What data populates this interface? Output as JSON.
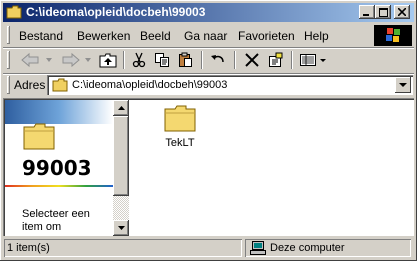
{
  "window": {
    "title": "C:\\ideoma\\opleid\\docbeh\\99003"
  },
  "menubar": {
    "items": [
      {
        "label": "Bestand"
      },
      {
        "label": "Bewerken"
      },
      {
        "label": "Beeld"
      },
      {
        "label": "Ga naar"
      },
      {
        "label": "Favorieten"
      },
      {
        "label": "Help"
      }
    ]
  },
  "toolbar": {
    "buttons": [
      "back-icon",
      "forward-icon",
      "up-folder-icon",
      "cut-icon",
      "copy-icon",
      "paste-icon",
      "undo-icon",
      "delete-icon",
      "properties-icon",
      "views-icon"
    ]
  },
  "address": {
    "label": "Adres",
    "value": "C:\\ideoma\\opleid\\docbeh\\99003"
  },
  "leftpane": {
    "folder_name": "99003",
    "description": "Selecteer een item om"
  },
  "files": [
    {
      "name": "TekLT",
      "icon": "folder-icon"
    }
  ],
  "status": {
    "count": "1 item(s)",
    "zone": "Deze computer"
  },
  "colors": {
    "titlebar_start": "#0a246a",
    "titlebar_end": "#a6caf0",
    "face": "#d4d0c8"
  }
}
